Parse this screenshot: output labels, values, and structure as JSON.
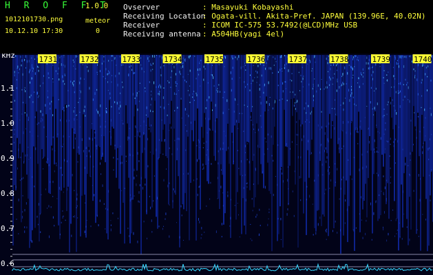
{
  "header": {
    "app_title": "H R O F F T",
    "version": "1.0.0",
    "file_name": "1012101730.png",
    "date_time": "10.12.10 17:30",
    "meteor_label": "meteor",
    "meteor_count": "0"
  },
  "info": [
    {
      "key": "Ovserver",
      "value": ": Masayuki Kobayashi"
    },
    {
      "key": "Receiving Location",
      "value": ": Ogata-vill. Akita-Pref. JAPAN (139.96E, 40.02N)"
    },
    {
      "key": "Receiver",
      "value": ": ICOM IC-575 53.7492(@LCD)MHz USB"
    },
    {
      "key": "Receiving antenna",
      "value": ": A504HB(yagi 4el)"
    }
  ],
  "chart_data": {
    "type": "heatmap",
    "ylabel": "kHz",
    "y_ticks": [
      "1.1",
      "1.0",
      "0.9",
      "0.8",
      "0.7",
      "0.6"
    ],
    "x_ticks": [
      "1731",
      "1732",
      "1733",
      "1734",
      "1735",
      "1736",
      "1737",
      "1738",
      "1739",
      "1740"
    ],
    "ylim": [
      0.575,
      1.2
    ]
  },
  "colors": {
    "background": "#000000",
    "signal_low": "#0a1a8a",
    "signal_high": "#40c8ff",
    "trace": "#39d8ff",
    "label_green": "#38ff38",
    "label_yellow": "#ffff3c"
  }
}
